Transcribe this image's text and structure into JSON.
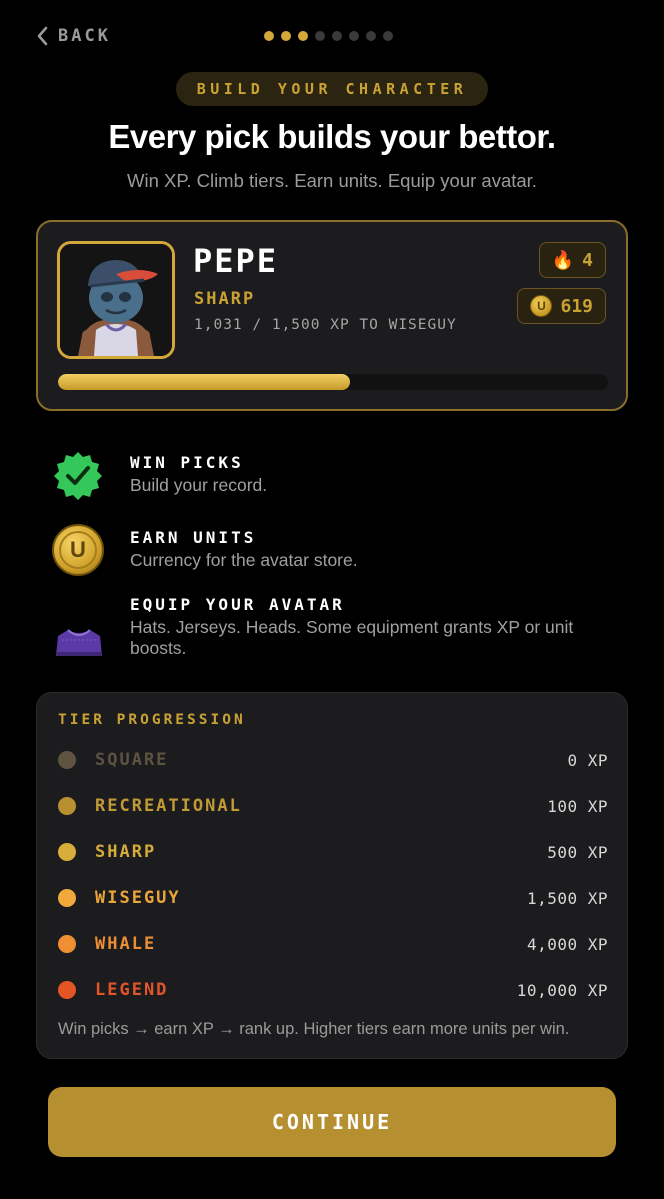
{
  "nav": {
    "back_label": "BACK",
    "step_current": 3,
    "step_total": 8
  },
  "header": {
    "badge": "BUILD YOUR CHARACTER",
    "title": "Every pick builds your bettor.",
    "subtitle": "Win XP. Climb tiers. Earn units. Equip your avatar."
  },
  "profile": {
    "name": "PEPE",
    "tier": "SHARP",
    "xp_text": "1,031 / 1,500 XP TO WISEGUY",
    "xp_progress": 0.53,
    "streak": "4",
    "units": "619",
    "coin_letter": "U"
  },
  "features": [
    {
      "icon": "check-badge-icon",
      "title": "WIN PICKS",
      "desc": "Build your record."
    },
    {
      "icon": "unit-coin-icon",
      "title": "EARN UNITS",
      "desc": "Currency for the avatar store."
    },
    {
      "icon": "jersey-icon",
      "title": "EQUIP YOUR AVATAR",
      "desc": "Hats. Jerseys. Heads. Some equipment grants XP or unit boosts."
    }
  ],
  "tiers": {
    "title": "TIER PROGRESSION",
    "rows": [
      {
        "name": "SQUARE",
        "xp": "0 XP",
        "color": "#5e5340",
        "text_color": "#5e5340"
      },
      {
        "name": "RECREATIONAL",
        "xp": "100 XP",
        "color": "#b8902f",
        "text_color": "#c29a35"
      },
      {
        "name": "SHARP",
        "xp": "500 XP",
        "color": "#d8ad3c",
        "text_color": "#d6ab3c"
      },
      {
        "name": "WISEGUY",
        "xp": "1,500 XP",
        "color": "#f0a93a",
        "text_color": "#eaa53b"
      },
      {
        "name": "WHALE",
        "xp": "4,000 XP",
        "color": "#ef8f33",
        "text_color": "#eb8e35"
      },
      {
        "name": "LEGEND",
        "xp": "10,000 XP",
        "color": "#e45526",
        "text_color": "#e2542a"
      }
    ],
    "footer": "Win picks → earn XP → rank up. Higher tiers earn more units per win."
  },
  "cta": {
    "label": "CONTINUE"
  },
  "colors": {
    "accent": "#c9a233",
    "background": "#000000",
    "card": "#1c1c1e"
  }
}
